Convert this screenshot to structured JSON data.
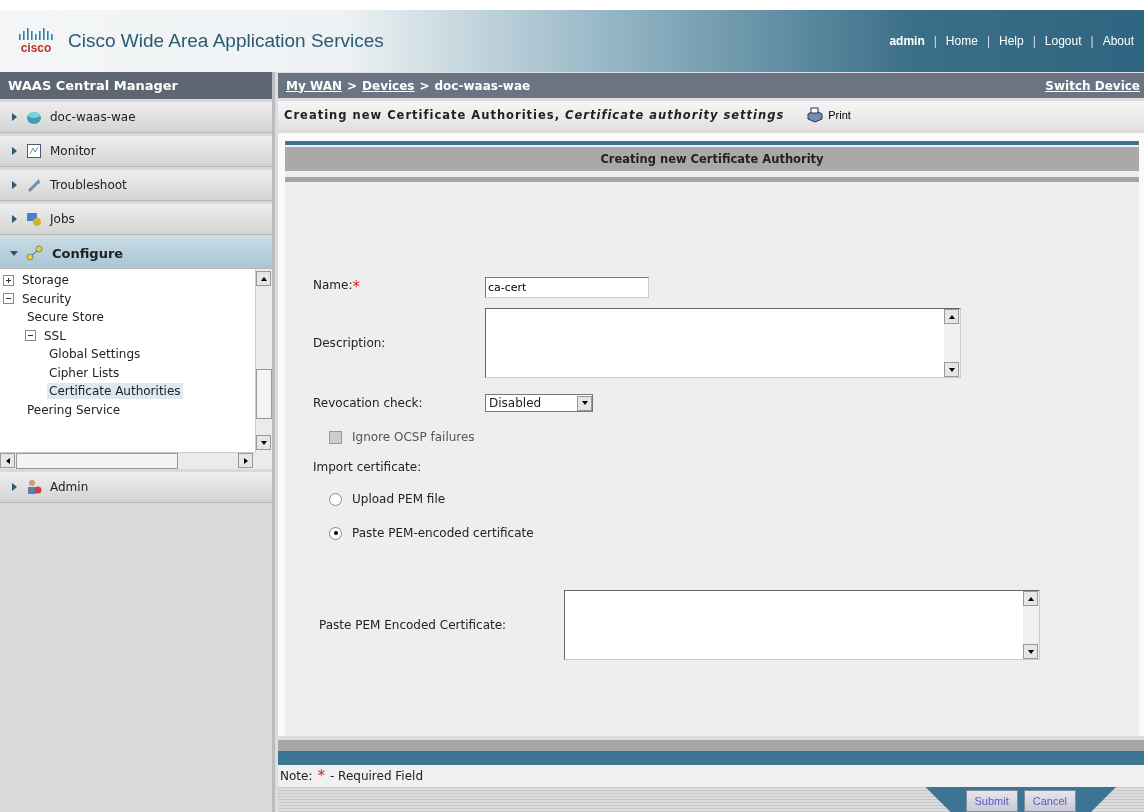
{
  "header": {
    "title": "Cisco Wide Area Application Services",
    "logo": "cisco",
    "user": "admin",
    "separator": "|",
    "links": [
      "Home",
      "Help",
      "Logout",
      "About"
    ]
  },
  "sidebar": {
    "title": "WAAS Central Manager",
    "items": [
      {
        "label": "doc-waas-wae",
        "expanded": false,
        "selected": false
      },
      {
        "label": "Monitor",
        "expanded": false,
        "selected": false
      },
      {
        "label": "Troubleshoot",
        "expanded": false,
        "selected": false
      },
      {
        "label": "Jobs",
        "expanded": false,
        "selected": false
      },
      {
        "label": "Configure",
        "expanded": true,
        "selected": true,
        "children": [
          {
            "label": "Storage",
            "expanded": false,
            "selected": false
          },
          {
            "label": "Security",
            "expanded": true,
            "selected": false,
            "children": [
              {
                "label": "Secure Store",
                "selected": false
              },
              {
                "label": "SSL",
                "expanded": true,
                "selected": false,
                "children": [
                  {
                    "label": "Global Settings",
                    "selected": false
                  },
                  {
                    "label": "Cipher Lists",
                    "selected": false
                  },
                  {
                    "label": "Certificate Authorities",
                    "selected": true
                  }
                ]
              },
              {
                "label": "Peering Service",
                "selected": false
              }
            ]
          }
        ]
      },
      {
        "label": "Admin",
        "expanded": false,
        "selected": false
      }
    ]
  },
  "breadcrumb": {
    "separator": ">",
    "links": [
      "My WAN",
      "Devices"
    ],
    "current": "doc-waas-wae",
    "switch": "Switch Device"
  },
  "page_title": {
    "text": "Creating new Certificate Authorities, *Certificate authority settings*",
    "print": "Print"
  },
  "form": {
    "heading": "Creating new Certificate Authority",
    "required_mark": "*",
    "fields": [
      {
        "kind": "text",
        "label": "Name:",
        "required": true,
        "value": "ca-cert"
      },
      {
        "kind": "textarea",
        "label": "Description:",
        "required": false
      },
      {
        "kind": "select",
        "label": "Revocation check:",
        "value": "Disabled"
      },
      {
        "kind": "checkbox",
        "label": "Ignore OCSP failures",
        "checked": false,
        "disabled": true
      },
      {
        "kind": "label",
        "label": "Import certificate:"
      },
      {
        "kind": "radio",
        "label": "Upload PEM file",
        "selected": false
      },
      {
        "kind": "radio",
        "label": "Paste PEM-encoded certificate",
        "selected": true
      },
      {
        "kind": "bigtextarea",
        "label": "Paste PEM Encoded Certificate:"
      }
    ]
  },
  "note": {
    "label": "Note:",
    "mark": "*",
    "text": "- Required Field"
  },
  "buttons": [
    "Submit",
    "Cancel"
  ]
}
